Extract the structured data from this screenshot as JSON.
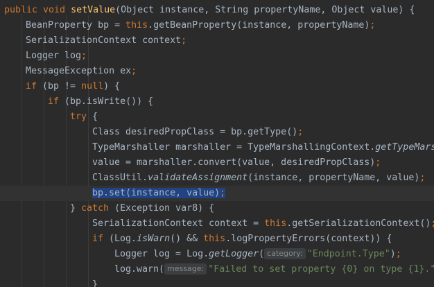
{
  "editor": {
    "colors": {
      "background": "#2b2b2b",
      "text": "#a9b7c6",
      "keyword": "#cc7832",
      "method": "#ffc66d",
      "string": "#6a8759",
      "selection": "#214283",
      "hint_bg": "#3b3f41"
    },
    "lines": [
      [
        [
          "public void ",
          "kw"
        ],
        [
          "setValue",
          "fn"
        ],
        [
          "(Object instance, String propertyName, Object value) {",
          ""
        ]
      ],
      [
        [
          "BeanProperty bp = ",
          ""
        ],
        [
          "this",
          "kw"
        ],
        [
          ".getBeanProperty(instance, propertyName)",
          ""
        ],
        [
          ";",
          "kw"
        ]
      ],
      [
        [
          "SerializationContext context",
          ""
        ],
        [
          ";",
          "kw"
        ]
      ],
      [
        [
          "Logger log",
          ""
        ],
        [
          ";",
          "kw"
        ]
      ],
      [
        [
          "MessageException ex",
          ""
        ],
        [
          ";",
          "kw"
        ]
      ],
      [
        [
          "if ",
          "kw"
        ],
        [
          "(bp != ",
          ""
        ],
        [
          "null",
          "kw"
        ],
        [
          ") {",
          ""
        ]
      ],
      [
        [
          "if ",
          "kw"
        ],
        [
          "(bp.isWrite()) {",
          ""
        ]
      ],
      [
        [
          "try ",
          "kw"
        ],
        [
          "{",
          ""
        ]
      ],
      [
        [
          "Class desiredPropClass = bp.getType()",
          ""
        ],
        [
          ";",
          "kw"
        ]
      ],
      [
        [
          "TypeMarshaller marshaller = TypeMarshallingContext.",
          ""
        ],
        [
          "getTypeMarshaller",
          "it"
        ]
      ],
      [
        [
          "value = marshaller.convert(value, desiredPropClass)",
          ""
        ],
        [
          ";",
          "kw"
        ]
      ],
      [
        [
          "ClassUtil.",
          ""
        ],
        [
          "validateAssignment",
          "it"
        ],
        [
          "(instance, propertyName, value)",
          ""
        ],
        [
          ";",
          "kw"
        ]
      ],
      [
        [
          "bp.set(instance, value)",
          "sel"
        ],
        [
          ";",
          "kw sel"
        ]
      ],
      [
        [
          "} ",
          ""
        ],
        [
          "catch ",
          "kw"
        ],
        [
          "(Exception var8) {",
          ""
        ]
      ],
      [
        [
          "SerializationContext context = ",
          ""
        ],
        [
          "this",
          "kw"
        ],
        [
          ".getSerializationContext()",
          ""
        ],
        [
          ";",
          "kw"
        ]
      ],
      [
        [
          "if ",
          "kw"
        ],
        [
          "(Log.",
          ""
        ],
        [
          "isWarn",
          "it"
        ],
        [
          "() && ",
          ""
        ],
        [
          "this",
          "kw"
        ],
        [
          ".logPropertyErrors(context)) {",
          ""
        ]
      ],
      [
        [
          "Logger log = Log.",
          ""
        ],
        [
          "getLogger",
          "it"
        ],
        [
          "(",
          ""
        ],
        [
          "category:",
          "hint"
        ],
        [
          "\"Endpoint.Type\"",
          "str"
        ],
        [
          ")",
          ""
        ],
        [
          ";",
          "kw"
        ]
      ],
      [
        [
          "log.warn(",
          ""
        ],
        [
          "message:",
          "hint"
        ],
        [
          "\"Failed to set property {0} on type {1}.\"",
          "str"
        ]
      ],
      [
        [
          "}",
          ""
        ]
      ]
    ]
  }
}
